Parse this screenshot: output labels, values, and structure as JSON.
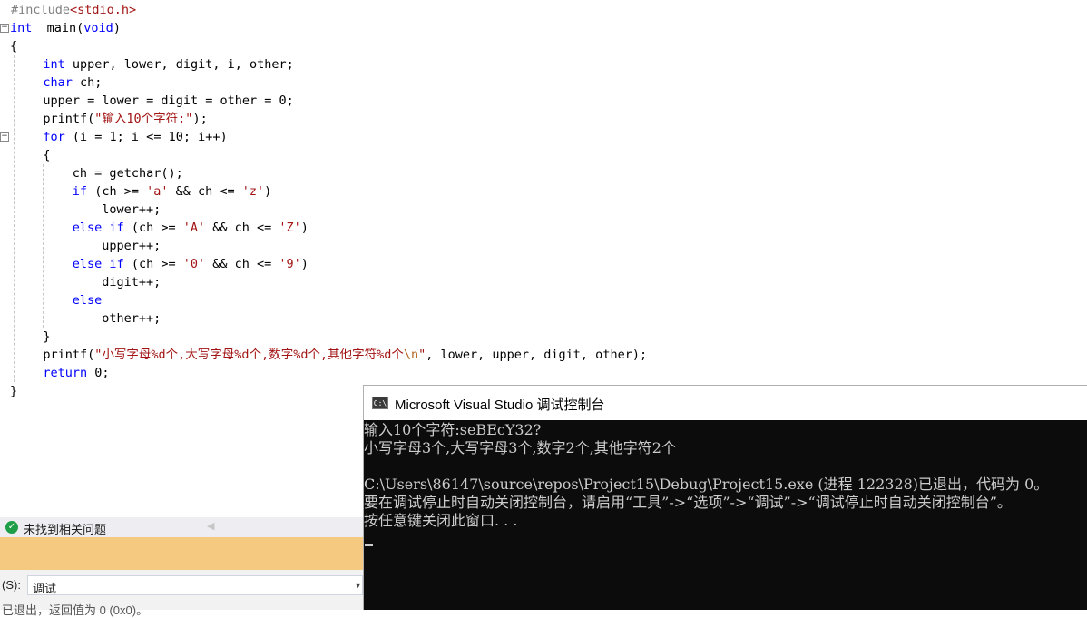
{
  "editor": {
    "lines": [
      {
        "fold": "",
        "indent": 0,
        "parts": [
          [
            "pp",
            "#include"
          ],
          [
            "str",
            "<stdio.h>"
          ]
        ]
      },
      {
        "fold": "−",
        "indent": 0,
        "parts": [
          [
            "kw",
            "int"
          ],
          [
            "",
            "  main("
          ],
          [
            "kw",
            "void"
          ],
          [
            "",
            ")"
          ]
        ]
      },
      {
        "fold": "",
        "indent": 0,
        "parts": [
          [
            "",
            "{"
          ]
        ]
      },
      {
        "fold": "",
        "indent": 4,
        "parts": [
          [
            "kw",
            "int"
          ],
          [
            "",
            " upper, lower, digit, i, other;"
          ]
        ]
      },
      {
        "fold": "",
        "indent": 4,
        "parts": [
          [
            "kw",
            "char"
          ],
          [
            "",
            " ch;"
          ]
        ]
      },
      {
        "fold": "",
        "indent": 4,
        "parts": [
          [
            "",
            "upper = lower = digit = other = 0;"
          ]
        ]
      },
      {
        "fold": "",
        "indent": 4,
        "parts": [
          [
            "",
            "printf("
          ],
          [
            "str",
            "\"输入10个字符:\""
          ],
          [
            "",
            ");"
          ]
        ]
      },
      {
        "fold": "−",
        "indent": 4,
        "parts": [
          [
            "kw",
            "for"
          ],
          [
            "",
            " (i = 1; i <= 10; i++)"
          ]
        ]
      },
      {
        "fold": "",
        "indent": 4,
        "parts": [
          [
            "",
            "{"
          ]
        ]
      },
      {
        "fold": "",
        "indent": 8,
        "parts": [
          [
            "",
            "ch = getchar();"
          ]
        ]
      },
      {
        "fold": "",
        "indent": 8,
        "parts": [
          [
            "kw",
            "if"
          ],
          [
            "",
            " (ch >= "
          ],
          [
            "str",
            "'a'"
          ],
          [
            "",
            " && ch <= "
          ],
          [
            "str",
            "'z'"
          ],
          [
            "",
            ")"
          ]
        ]
      },
      {
        "fold": "",
        "indent": 12,
        "parts": [
          [
            "",
            "lower++;"
          ]
        ]
      },
      {
        "fold": "",
        "indent": 8,
        "parts": [
          [
            "kw",
            "else if"
          ],
          [
            "",
            " (ch >= "
          ],
          [
            "str",
            "'A'"
          ],
          [
            "",
            " && ch <= "
          ],
          [
            "str",
            "'Z'"
          ],
          [
            "",
            ")"
          ]
        ]
      },
      {
        "fold": "",
        "indent": 12,
        "parts": [
          [
            "",
            "upper++;"
          ]
        ]
      },
      {
        "fold": "",
        "indent": 8,
        "parts": [
          [
            "kw",
            "else if"
          ],
          [
            "",
            " (ch >= "
          ],
          [
            "str",
            "'0'"
          ],
          [
            "",
            " && ch <= "
          ],
          [
            "str",
            "'9'"
          ],
          [
            "",
            ")"
          ]
        ]
      },
      {
        "fold": "",
        "indent": 12,
        "parts": [
          [
            "",
            "digit++;"
          ]
        ]
      },
      {
        "fold": "",
        "indent": 8,
        "parts": [
          [
            "kw",
            "else"
          ]
        ]
      },
      {
        "fold": "",
        "indent": 12,
        "parts": [
          [
            "",
            "other++;"
          ]
        ]
      },
      {
        "fold": "",
        "indent": 4,
        "parts": [
          [
            "",
            "}"
          ]
        ]
      },
      {
        "fold": "",
        "indent": 4,
        "parts": [
          [
            "",
            "printf("
          ],
          [
            "str",
            "\"小写字母%d个,大写字母%d个,数字%d个,其他字符%d个"
          ],
          [
            "esc",
            "\\n"
          ],
          [
            "str",
            "\""
          ],
          [
            "",
            ", lower, upper, digit, other);"
          ]
        ]
      },
      {
        "fold": "",
        "indent": 4,
        "parts": [
          [
            "kw",
            "return"
          ],
          [
            "",
            " 0;"
          ]
        ]
      },
      {
        "fold": "",
        "indent": 0,
        "parts": [
          [
            "",
            "}"
          ]
        ]
      }
    ]
  },
  "issues": {
    "icon": "check-circle-icon",
    "text": "未找到相关问题"
  },
  "output_panel": {
    "source_label": "(S):",
    "source_value": "调试",
    "cut_text": "已退出，返回值为 0 (0x0)。"
  },
  "console": {
    "icon": "console-app-icon",
    "icon_text": "C:\\",
    "title": "Microsoft Visual Studio 调试控制台",
    "lines": [
      "输入10个字符:seBEcY32?",
      "小写字母3个,大写字母3个,数字2个,其他字符2个",
      "",
      "C:\\Users\\86147\\source\\repos\\Project15\\Debug\\Project15.exe (进程 122328)已退出，代码为 0。",
      "要在调试停止时自动关闭控制台，请启用“工具”->“选项”->“调试”->“调试停止时自动关闭控制台”。",
      "按任意键关闭此窗口. . ."
    ]
  }
}
